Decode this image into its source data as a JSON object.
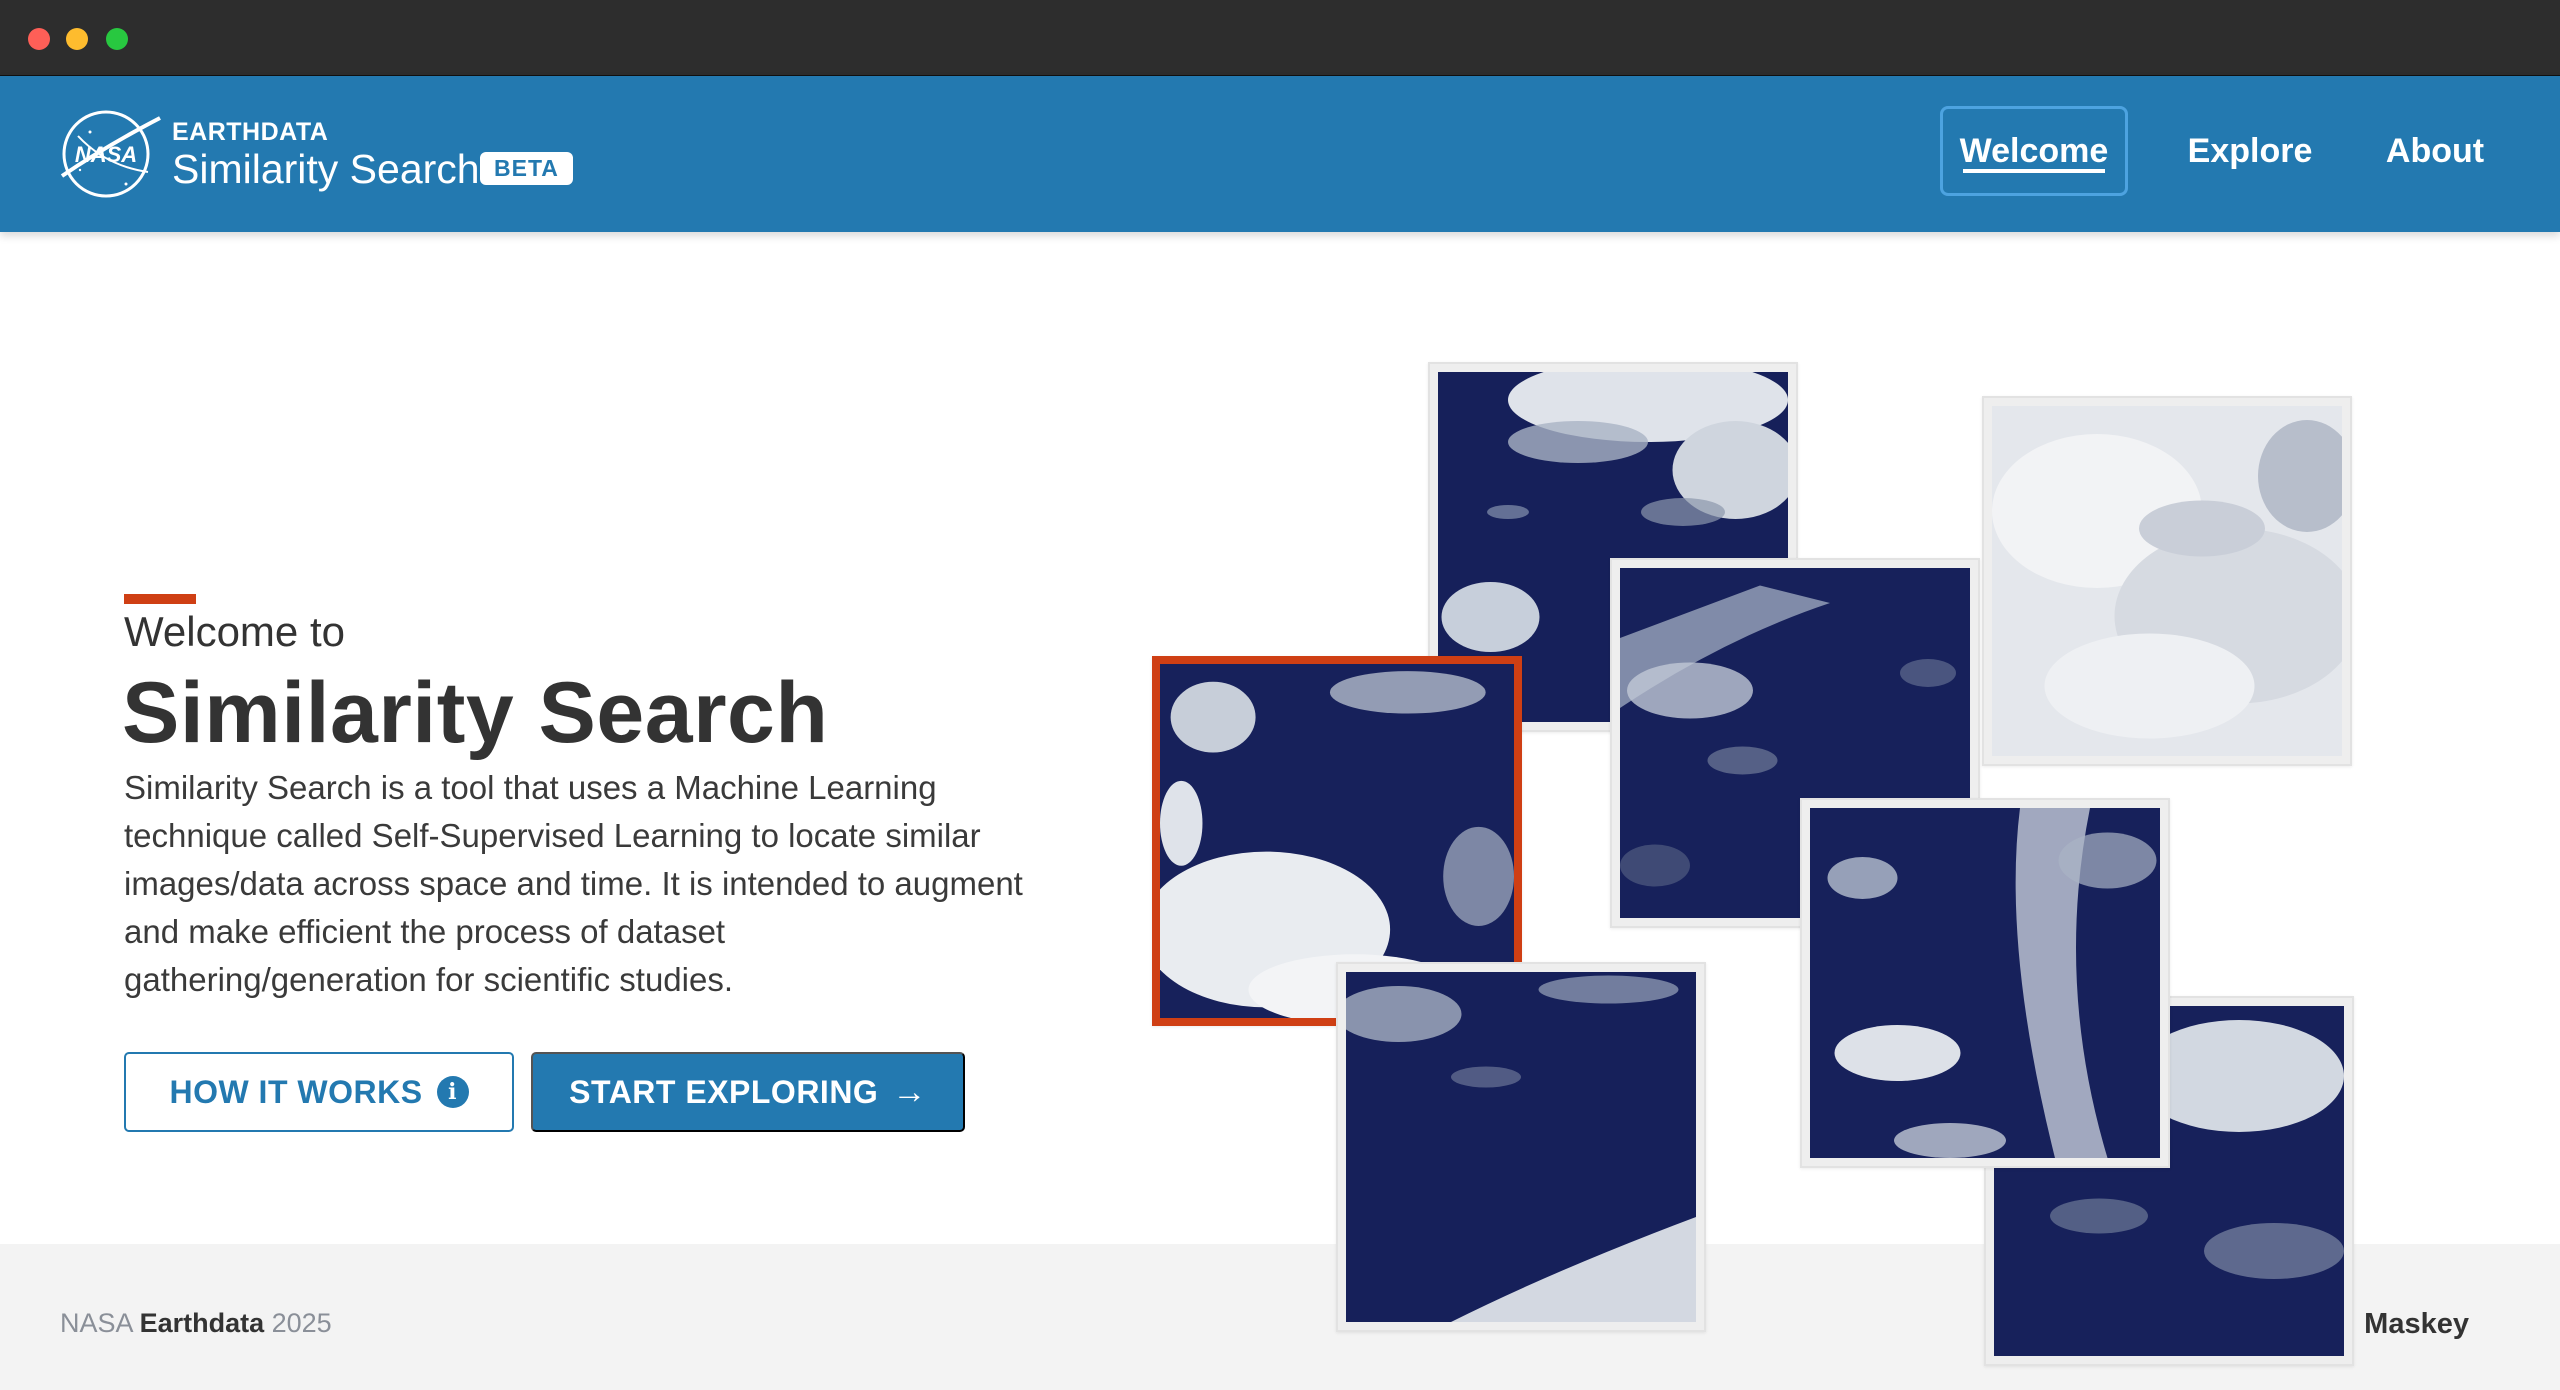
{
  "window": {
    "controls": [
      "close",
      "minimize",
      "zoom"
    ]
  },
  "header": {
    "logo": "NASA",
    "brand_top": "EARTHDATA",
    "brand_main": "Similarity Search",
    "badge": "BETA",
    "nav": [
      {
        "label": "Welcome",
        "active": true
      },
      {
        "label": "Explore",
        "active": false
      },
      {
        "label": "About",
        "active": false
      }
    ]
  },
  "hero": {
    "kicker": "Welcome to",
    "title": "Similarity Search",
    "description": "Similarity Search is a tool that uses a Machine Learning technique called Self-Supervised Learning to locate similar images/data across space and time. It is intended to augment and make efficient the process of dataset gathering/generation for scientific studies.",
    "buttons": {
      "how_it_works": "HOW IT WORKS",
      "start_exploring": "START EXPLORING"
    }
  },
  "gallery": {
    "tiles": [
      "satellite-clouds-1",
      "satellite-clouds-2",
      "satellite-clouds-3",
      "satellite-clouds-4",
      "satellite-clouds-5",
      "satellite-clouds-6",
      "satellite-clouds-7",
      "satellite-clouds-8"
    ],
    "selected_tile": "satellite-clouds-4"
  },
  "footer": {
    "prefix": "NASA",
    "brand": "Earthdata",
    "year": "2025",
    "contact": "Manil Maskey"
  },
  "colors": {
    "brand_blue": "#2379b0",
    "accent_orange": "#cf3f14",
    "ocean_navy": "#16205a"
  },
  "icons": [
    "nasa-logo-icon",
    "info-icon",
    "arrow-right-icon",
    "mail-icon"
  ]
}
